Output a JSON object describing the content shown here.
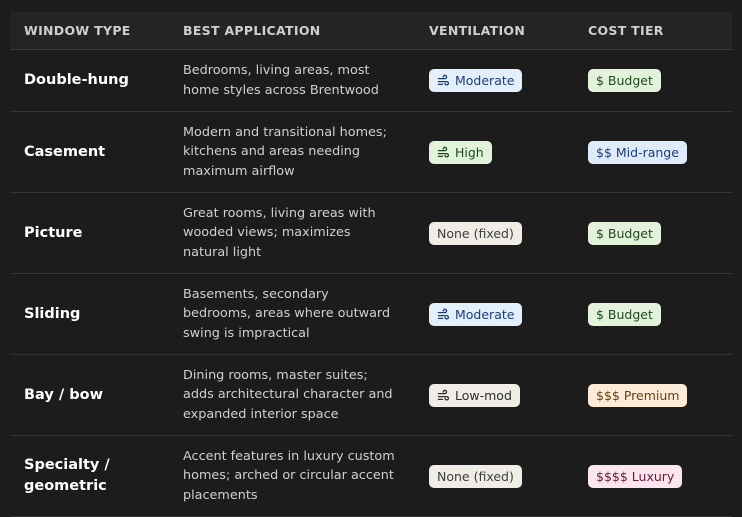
{
  "headers": [
    "WINDOW TYPE",
    "BEST APPLICATION",
    "VENTILATION",
    "COST TIER"
  ],
  "rows": [
    {
      "type": "Double-hung",
      "application": "Bedrooms, living areas, most home styles across Brentwood",
      "ventilation": "Moderate",
      "vent_style": "moderate",
      "vent_icon": "wind-icon",
      "cost": "$ Budget",
      "cost_style": "budget"
    },
    {
      "type": "Casement",
      "application": "Modern and transitional homes; kitchens and areas needing maximum airflow",
      "ventilation": "High",
      "vent_style": "high",
      "vent_icon": "wind-icon",
      "cost": "$$ Mid-range",
      "cost_style": "mid"
    },
    {
      "type": "Picture",
      "application": "Great rooms, living areas with wooded views; maximizes natural light",
      "ventilation": "None (fixed)",
      "vent_style": "none",
      "vent_icon": "",
      "cost": "$ Budget",
      "cost_style": "budget"
    },
    {
      "type": "Sliding",
      "application": "Basements, secondary bedrooms, areas where outward swing is impractical",
      "ventilation": "Moderate",
      "vent_style": "moderate",
      "vent_icon": "wind-icon",
      "cost": "$ Budget",
      "cost_style": "budget"
    },
    {
      "type": "Bay / bow",
      "application": "Dining rooms, master suites; adds architectural character and expanded interior space",
      "ventilation": "Low-mod",
      "vent_style": "low",
      "vent_icon": "wind-icon",
      "cost": "$$$ Premium",
      "cost_style": "premium"
    },
    {
      "type": "Specialty / geometric",
      "application": "Accent features in luxury custom homes; arched or circular accent placements",
      "ventilation": "None (fixed)",
      "vent_style": "none",
      "vent_icon": "",
      "cost": "$$$$ Luxury",
      "cost_style": "luxury"
    }
  ]
}
